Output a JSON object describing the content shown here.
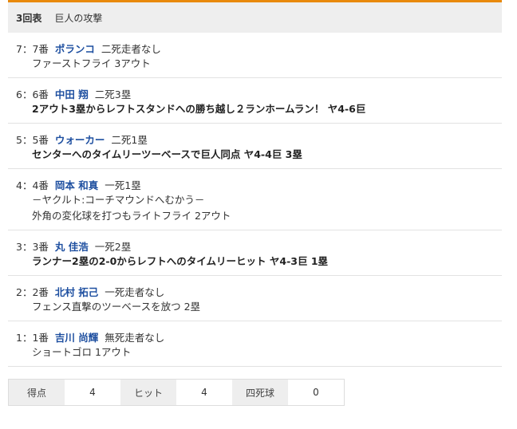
{
  "header": {
    "inning": "3回表",
    "team": "巨人の攻撃"
  },
  "plays": [
    {
      "order": "7：7番",
      "player": "ポランコ",
      "situation": "二死走者なし",
      "lines": [
        "ファーストフライ 3アウト"
      ],
      "bold": false
    },
    {
      "order": "6：6番",
      "player": "中田 翔",
      "situation": "二死3塁",
      "lines": [
        "2アウト3塁からレフトスタンドへの勝ち越し２ランホームラン！ ヤ4-6巨"
      ],
      "bold": true
    },
    {
      "order": "5：5番",
      "player": "ウォーカー",
      "situation": "二死1塁",
      "lines": [
        "センターへのタイムリーツーベースで巨人同点 ヤ4-4巨 3塁"
      ],
      "bold": true
    },
    {
      "order": "4：4番",
      "player": "岡本 和真",
      "situation": "一死1塁",
      "lines": [
        "－ヤクルト:コーチマウンドへむかう－",
        "外角の変化球を打つもライトフライ 2アウト"
      ],
      "bold": false
    },
    {
      "order": "3：3番",
      "player": "丸 佳浩",
      "situation": "一死2塁",
      "lines": [
        "ランナー2塁の2-0からレフトへのタイムリーヒット ヤ4-3巨 1塁"
      ],
      "bold": true
    },
    {
      "order": "2：2番",
      "player": "北村 拓己",
      "situation": "一死走者なし",
      "lines": [
        "フェンス直撃のツーベースを放つ 2塁"
      ],
      "bold": false
    },
    {
      "order": "1：1番",
      "player": "吉川 尚輝",
      "situation": "無死走者なし",
      "lines": [
        "ショートゴロ 1アウト"
      ],
      "bold": false
    }
  ],
  "stats": [
    {
      "label": "得点",
      "value": "4"
    },
    {
      "label": "ヒット",
      "value": "4"
    },
    {
      "label": "四死球",
      "value": "0"
    }
  ],
  "colors": {
    "accent": "#e8890c",
    "player": "#1e4fa0",
    "header_bg": "#eeeeee"
  }
}
